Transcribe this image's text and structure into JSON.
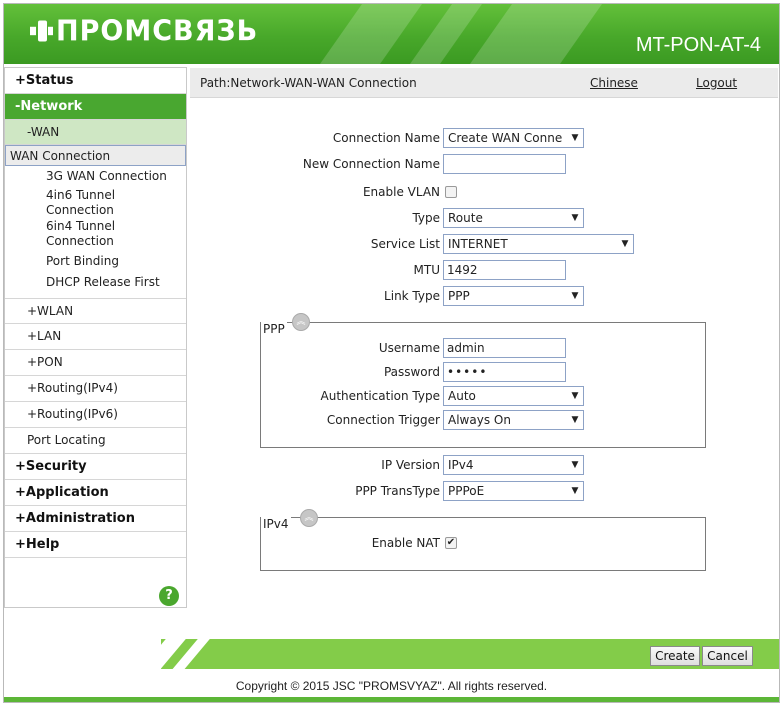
{
  "brand": {
    "logo_text": "ПРОМСВЯЗЬ",
    "model": "MT-PON-AT-4",
    "accent": "#49a730"
  },
  "sidebar": {
    "items": [
      {
        "label": "+Status"
      },
      {
        "label": "-Network"
      },
      {
        "label": "-WAN"
      },
      {
        "label": "WAN Connection"
      },
      {
        "label": "3G WAN Connection"
      },
      {
        "label": "4in6 Tunnel Connection"
      },
      {
        "label": "6in4 Tunnel Connection"
      },
      {
        "label": "Port Binding"
      },
      {
        "label": "DHCP Release First"
      },
      {
        "label": "+WLAN"
      },
      {
        "label": "+LAN"
      },
      {
        "label": "+PON"
      },
      {
        "label": "+Routing(IPv4)"
      },
      {
        "label": "+Routing(IPv6)"
      },
      {
        "label": "Port Locating"
      },
      {
        "label": "+Security"
      },
      {
        "label": "+Application"
      },
      {
        "label": "+Administration"
      },
      {
        "label": "+Help"
      }
    ],
    "help_icon": "?"
  },
  "pathbar": {
    "path": "Path:Network-WAN-WAN Connection",
    "chinese": "Chinese",
    "logout": "Logout"
  },
  "form": {
    "connection_name": {
      "label": "Connection Name",
      "value": "Create WAN Conne"
    },
    "new_connection_name": {
      "label": "New Connection Name",
      "value": ""
    },
    "enable_vlan": {
      "label": "Enable VLAN",
      "checked": false
    },
    "type": {
      "label": "Type",
      "value": "Route"
    },
    "service_list": {
      "label": "Service List",
      "value": "INTERNET"
    },
    "mtu": {
      "label": "MTU",
      "value": "1492"
    },
    "link_type": {
      "label": "Link Type",
      "value": "PPP"
    },
    "ppp": {
      "title": "PPP",
      "username": {
        "label": "Username",
        "value": "admin"
      },
      "password": {
        "label": "Password",
        "value": "•••••"
      },
      "auth_type": {
        "label": "Authentication Type",
        "value": "Auto"
      },
      "conn_trigger": {
        "label": "Connection Trigger",
        "value": "Always On"
      }
    },
    "ip_version": {
      "label": "IP Version",
      "value": "IPv4"
    },
    "ppp_transtype": {
      "label": "PPP TransType",
      "value": "PPPoE"
    },
    "ipv4": {
      "title": "IPv4",
      "enable_nat": {
        "label": "Enable NAT",
        "checked": true
      }
    }
  },
  "buttons": {
    "create": "Create",
    "cancel": "Cancel"
  },
  "footer": {
    "copyright": "Copyright © 2015 JSC \"PROMSVYAZ\". All rights reserved."
  }
}
